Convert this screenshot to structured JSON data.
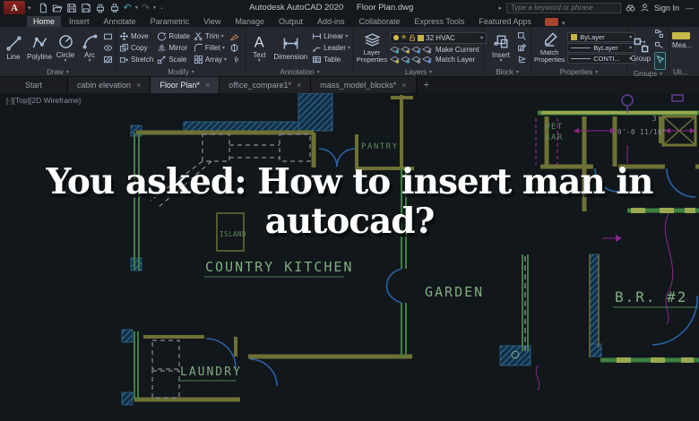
{
  "titlebar": {
    "app_title": "Autodesk AutoCAD 2020",
    "doc_title": "Floor Plan.dwg",
    "search_placeholder": "Type a keyword or phrase",
    "sign_in_label": "Sign In"
  },
  "glyphs": {
    "logo_letter": "A",
    "caret_down": "▾",
    "caret_small": "⌄",
    "undo_arrow": "↶",
    "redo_arrow": "↷",
    "expand_arrow": "▸",
    "minimize": "—",
    "close": "×",
    "plus": "+",
    "sun": "☀",
    "text_tool_glyph": "A"
  },
  "ribbon": {
    "active_tab": "Home",
    "tabs": [
      "Home",
      "Insert",
      "Annotate",
      "Parametric",
      "View",
      "Manage",
      "Output",
      "Add-ins",
      "Collaborate",
      "Express Tools",
      "Featured Apps"
    ],
    "panels": {
      "draw": {
        "label": "Draw",
        "tools": [
          "Line",
          "Polyline",
          "Circle",
          "Arc"
        ]
      },
      "modify": {
        "label": "Modify",
        "tools": [
          "Move",
          "Copy",
          "Stretch",
          "Rotate",
          "Mirror",
          "Scale",
          "Trim",
          "Fillet",
          "Array"
        ]
      },
      "annotation": {
        "label": "Annotation",
        "tools": [
          "Text",
          "Dimension",
          "Linear",
          "Leader",
          "Table"
        ]
      },
      "layers": {
        "label": "Layers",
        "layer_properties_tool": "Layer Properties",
        "current_layer": "32 HVAC",
        "make_current_tool": "Make Current",
        "match_layer_tool": "Match Layer"
      },
      "block": {
        "label": "Block",
        "insert_tool": "Insert"
      },
      "properties": {
        "label": "Properties",
        "match_properties_tool": "Match Properties",
        "object_color": "ByLayer",
        "lineweight": "ByLayer",
        "linetype": "CONTI..."
      },
      "groups": {
        "label": "Groups",
        "group_tool": "Group"
      },
      "utilities": {
        "label": "Uti...",
        "measure_tool": "Mea..."
      }
    }
  },
  "file_tabs": {
    "start": "Start",
    "items": [
      "cabin elevation",
      "Floor Plan*",
      "office_compare1*",
      "mass_model_blocks*"
    ],
    "active": "Floor Plan*"
  },
  "viewport": {
    "controls_label": "[-][Top][2D Wireframe]"
  },
  "overlay": {
    "line1": "You asked: How to insert man in",
    "line2": "autocad?"
  },
  "floor_plan": {
    "labels": {
      "pantry": "PANTRY",
      "wet_bar_line1": "WET",
      "wet_bar_line2": "BAR",
      "island": "ISLAND",
      "country_kitchen": "COUNTRY KITCHEN",
      "garden": "GARDEN",
      "bedroom_2": "B.R. #2",
      "laundry": "LAUNDRY"
    },
    "dimensions": {
      "dim_3ft": "3'",
      "dim_9ft": "9'-0 11/16\""
    }
  },
  "colors": {
    "logo_red": "#b5342d",
    "wall_olive": "#6e7134",
    "wall_green": "#3f8040",
    "window_green": "#9aa94f",
    "label_green": "#7fae7f",
    "door_blue": "#2a62a8",
    "dim_magenta": "#8a2a8a",
    "hatch_blue": "#3e7fae",
    "layer_yellow": "#c3b445"
  }
}
